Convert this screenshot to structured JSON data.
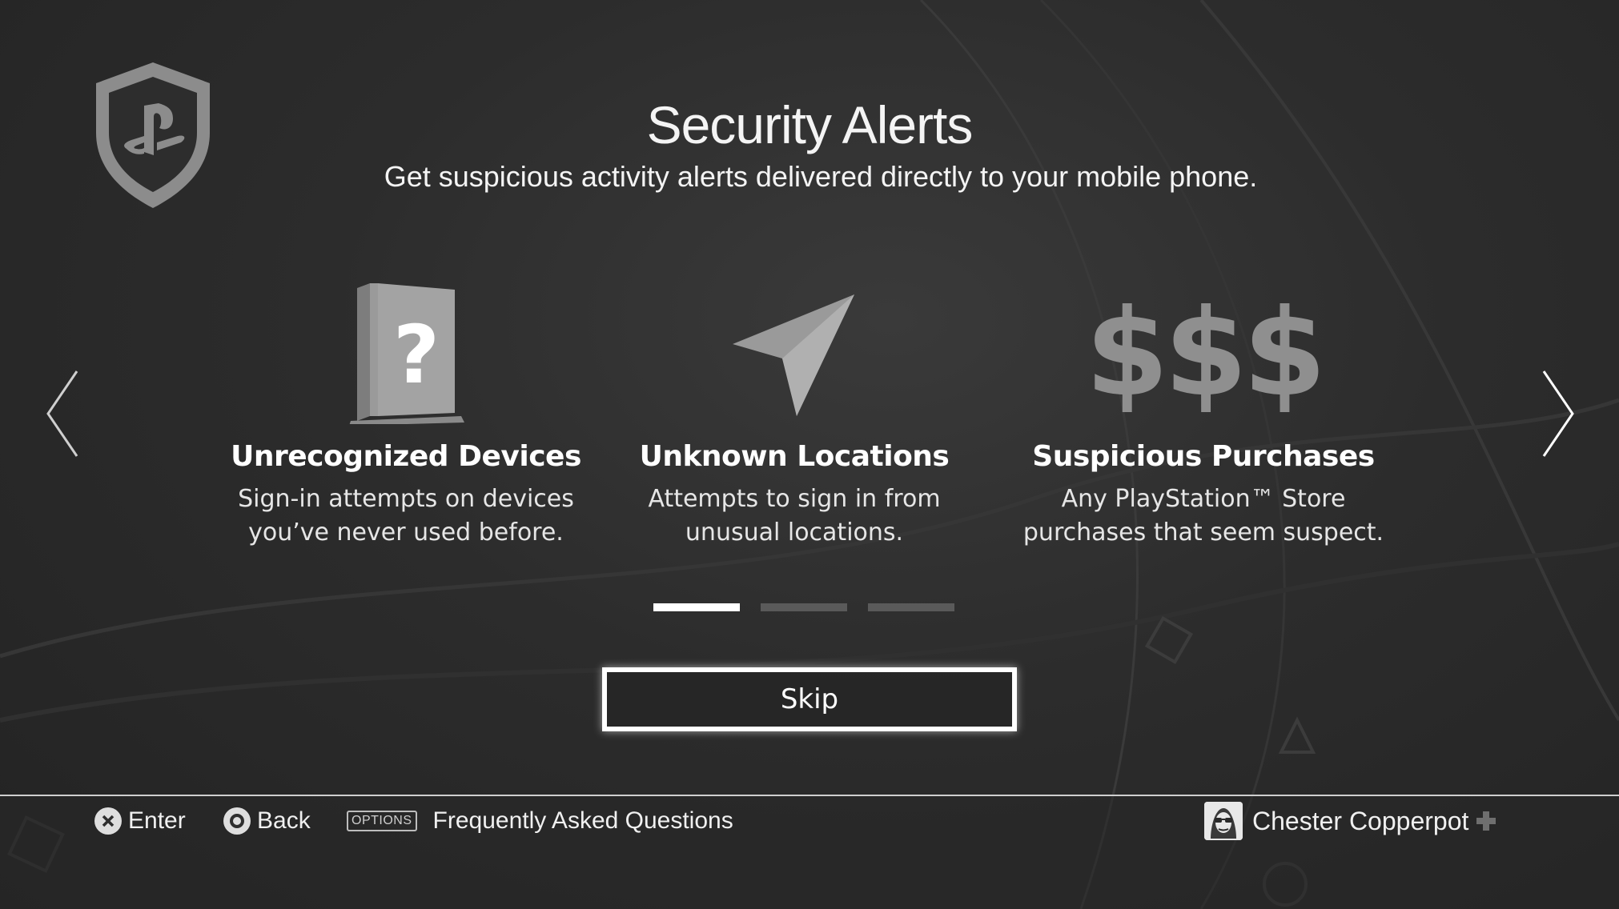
{
  "header": {
    "title": "Security Alerts",
    "subtitle": "Get suspicious activity alerts delivered directly to your mobile phone."
  },
  "icons": {
    "shield": "playstation-shield-icon",
    "prev": "chevron-left-icon",
    "next": "chevron-right-icon",
    "console": "console-question-icon",
    "location": "location-arrow-icon",
    "dollars": "dollar-signs-icon",
    "cross": "cross-button-icon",
    "circle": "circle-button-icon",
    "plus": "playstation-plus-icon"
  },
  "features": [
    {
      "icon_text": "?",
      "title": "Unrecognized Devices",
      "line1": "Sign-in attempts on devices",
      "line2": "you’ve never used before."
    },
    {
      "title": "Unknown Locations",
      "line1": "Attempts to sign in from",
      "line2": "unusual locations."
    },
    {
      "icon_text": "$$$",
      "title": "Suspicious Purchases",
      "line1": "Any PlayStation™ Store",
      "line2": "purchases that seem suspect."
    }
  ],
  "pager": {
    "total": 3,
    "current": 1
  },
  "skip_label": "Skip",
  "footer": {
    "enter_label": "Enter",
    "back_label": "Back",
    "options_badge": "OPTIONS",
    "faq_label": "Frequently Asked Questions",
    "username": "Chester Copperpot"
  },
  "colors": {
    "background": "#2b2b2b",
    "icon_gray": "#8f8f8f",
    "text": "#ffffff",
    "pager_inactive": "#5a5a5a"
  }
}
